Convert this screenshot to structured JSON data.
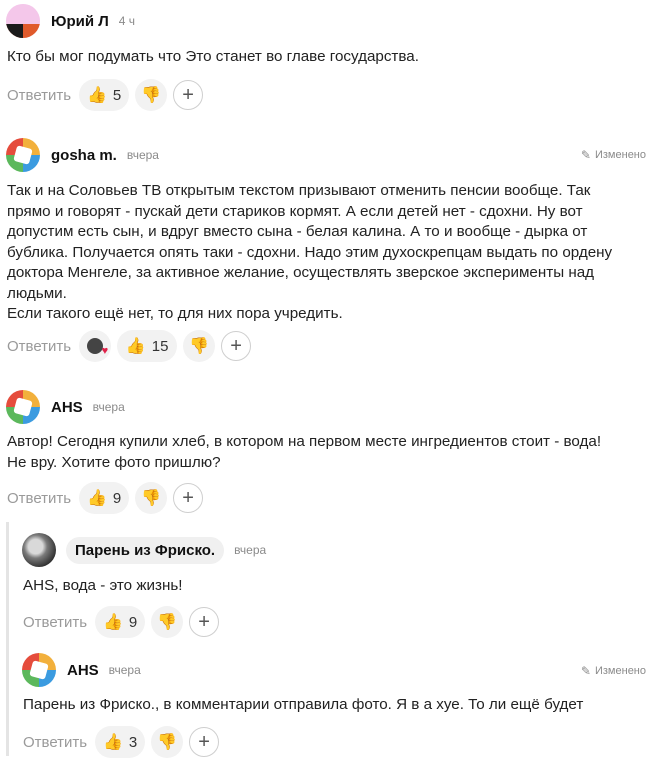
{
  "ui": {
    "reply_label": "Ответить",
    "edited_label": "Изменено"
  },
  "comments": [
    {
      "author": "Юрий Л",
      "time": "4 ч",
      "text": [
        "Кто бы мог подумать что Это станет во главе государства."
      ],
      "likes": "5"
    },
    {
      "author": "gosha m.",
      "time": "вчера",
      "edited": true,
      "text": [
        "Так и на Соловьев ТВ открытым текстом призывают отменить пенсии вообще. Так",
        "прямо и говорят - пускай дети стариков кормят. А если детей нет - сдохни. Ну вот",
        "допустим есть сын, и вдруг вместо сына - белая калина. А то и вообще - дырка от",
        "бублика. Получается опять таки - сдохни. Надо этим духоскрепцам выдать по ордену",
        "доктора Менгеле, за активное желание, осуществлять зверское эксперименты над",
        "людьми.",
        "Если такого ещё нет, то для них пора учредить."
      ],
      "likes": "15"
    },
    {
      "author": "AHS",
      "time": "вчера",
      "text": [
        "Автор! Сегодня купили хлеб, в котором на первом месте ингредиентов стоит - вода!",
        "Не вру. Хотите фото пришлю?"
      ],
      "likes": "9"
    },
    {
      "author": "Парень из Фриско.",
      "time": "вчера",
      "text": [
        "AHS, вода - это жизнь!"
      ],
      "likes": "9"
    },
    {
      "author": "AHS",
      "time": "вчера",
      "edited": true,
      "text": [
        "Парень из Фриско., в комментарии отправила фото. Я в а хуе. То ли ещё будет"
      ],
      "likes": "3"
    }
  ]
}
